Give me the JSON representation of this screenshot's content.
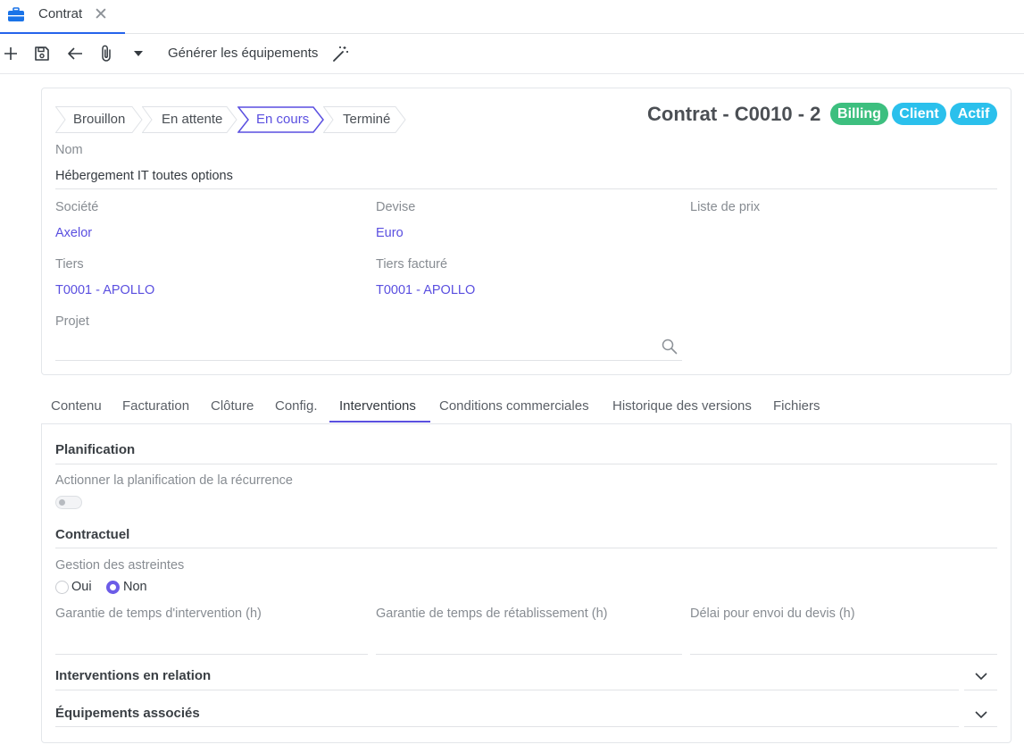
{
  "tab": {
    "label": "Contrat",
    "icon": "briefcase-icon",
    "close": "✕"
  },
  "toolbar": {
    "new_icon": "plus-icon",
    "save_icon": "floppy-icon",
    "back_icon": "arrow-left-icon",
    "attach_icon": "paperclip-icon",
    "more_icon": "caret-down-icon",
    "action_label": "Générer les équipements",
    "magic_icon": "magic-wand-icon"
  },
  "status_steps": [
    {
      "label": "Brouillon",
      "active": false
    },
    {
      "label": "En attente",
      "active": false
    },
    {
      "label": "En cours",
      "active": true
    },
    {
      "label": "Terminé",
      "active": false
    }
  ],
  "record": {
    "title": "Contrat - C0010 - 2",
    "badges": [
      {
        "label": "Billing",
        "color": "#3dbf7f"
      },
      {
        "label": "Client",
        "color": "#2bc0ec"
      },
      {
        "label": "Actif",
        "color": "#2bc0ec"
      }
    ]
  },
  "fields": {
    "nom_label": "Nom",
    "nom_value": "Hébergement IT toutes options",
    "societe_label": "Société",
    "societe_value": "Axelor",
    "devise_label": "Devise",
    "devise_value": "Euro",
    "liste_prix_label": "Liste de prix",
    "tiers_label": "Tiers",
    "tiers_value": "T0001 - APOLLO",
    "tiers_facture_label": "Tiers facturé",
    "tiers_facture_value": "T0001 - APOLLO",
    "projet_label": "Projet"
  },
  "form_tabs": [
    {
      "label": "Contenu",
      "active": false
    },
    {
      "label": "Facturation",
      "active": false
    },
    {
      "label": "Clôture",
      "active": false
    },
    {
      "label": "Config.",
      "active": false
    },
    {
      "label": "Interventions",
      "active": true
    },
    {
      "label": "Conditions commerciales",
      "active": false
    },
    {
      "label": "Historique des versions",
      "active": false
    },
    {
      "label": "Fichiers",
      "active": false
    }
  ],
  "interventions": {
    "planification_title": "Planification",
    "recurrence_label": "Actionner la planification de la récurrence",
    "recurrence_enabled": false,
    "contractuel_title": "Contractuel",
    "astreintes_label": "Gestion des astreintes",
    "astreintes_options": [
      "Oui",
      "Non"
    ],
    "astreintes_selected": "Non",
    "garantie_intervention_label": "Garantie de temps d'intervention (h)",
    "garantie_retablissement_label": "Garantie de temps de rétablissement (h)",
    "delai_devis_label": "Délai pour envoi du devis (h)",
    "interventions_relation_title": "Interventions en relation",
    "equipements_title": "Équipements associés"
  },
  "colors": {
    "accent": "#5a4fe0",
    "toolbar_blue": "#2563eb"
  }
}
